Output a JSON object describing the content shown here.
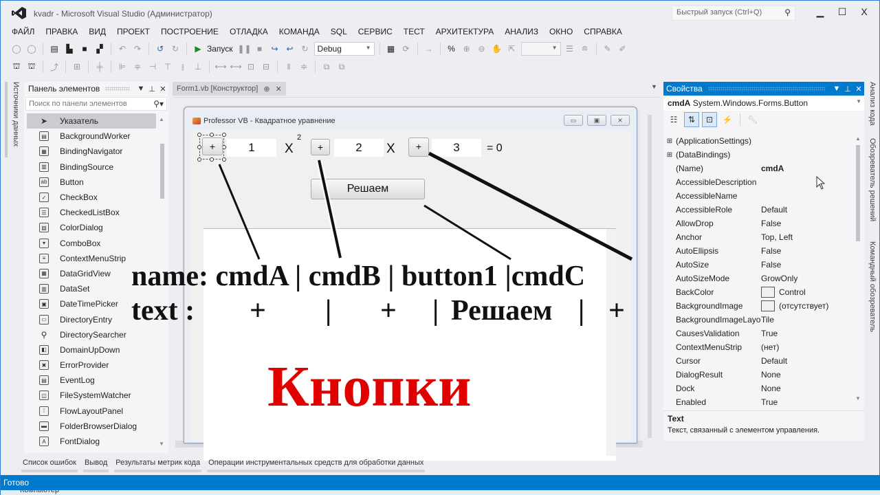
{
  "window": {
    "title": "kvadr - Microsoft Visual Studio (Администратор)",
    "quick_launch_placeholder": "Быстрый запуск (Ctrl+Q)",
    "controls": {
      "minimize": "▁",
      "maximize": "☐",
      "close": "X"
    }
  },
  "menu": [
    "ФАЙЛ",
    "ПРАВКА",
    "ВИД",
    "ПРОЕКТ",
    "ПОСТРОЕНИЕ",
    "ОТЛАДКА",
    "КОМАНДА",
    "SQL",
    "СЕРВИС",
    "ТЕСТ",
    "АРХИТЕКТУРА",
    "АНАЛИЗ",
    "ОКНО",
    "СПРАВКА"
  ],
  "toolbar": {
    "start_label": "Запуск",
    "configuration": "Debug"
  },
  "left_side_tab": "Источники данных",
  "toolbox": {
    "title": "Панель элементов",
    "search_placeholder": "Поиск по панели элементов",
    "items": [
      {
        "label": "Указатель",
        "icon": "pointer-icon",
        "glyph": "➤",
        "selected": true
      },
      {
        "label": "BackgroundWorker",
        "icon": "background-worker-icon",
        "glyph": "▤"
      },
      {
        "label": "BindingNavigator",
        "icon": "binding-navigator-icon",
        "glyph": "▦"
      },
      {
        "label": "BindingSource",
        "icon": "binding-source-icon",
        "glyph": "▥"
      },
      {
        "label": "Button",
        "icon": "button-icon",
        "glyph": "ab"
      },
      {
        "label": "CheckBox",
        "icon": "checkbox-icon",
        "glyph": "✓"
      },
      {
        "label": "CheckedListBox",
        "icon": "checked-list-box-icon",
        "glyph": "☰"
      },
      {
        "label": "ColorDialog",
        "icon": "color-dialog-icon",
        "glyph": "▧"
      },
      {
        "label": "ComboBox",
        "icon": "combobox-icon",
        "glyph": "▾"
      },
      {
        "label": "ContextMenuStrip",
        "icon": "context-menu-strip-icon",
        "glyph": "≡"
      },
      {
        "label": "DataGridView",
        "icon": "datagridview-icon",
        "glyph": "▦"
      },
      {
        "label": "DataSet",
        "icon": "dataset-icon",
        "glyph": "▥"
      },
      {
        "label": "DateTimePicker",
        "icon": "datetimepicker-icon",
        "glyph": "▣"
      },
      {
        "label": "DirectoryEntry",
        "icon": "directory-entry-icon",
        "glyph": "▭"
      },
      {
        "label": "DirectorySearcher",
        "icon": "directory-searcher-icon",
        "glyph": "⚲"
      },
      {
        "label": "DomainUpDown",
        "icon": "domain-up-down-icon",
        "glyph": "◧"
      },
      {
        "label": "ErrorProvider",
        "icon": "error-provider-icon",
        "glyph": "✖"
      },
      {
        "label": "EventLog",
        "icon": "event-log-icon",
        "glyph": "▤"
      },
      {
        "label": "FileSystemWatcher",
        "icon": "file-system-watcher-icon",
        "glyph": "◫"
      },
      {
        "label": "FlowLayoutPanel",
        "icon": "flow-layout-panel-icon",
        "glyph": "⁞"
      },
      {
        "label": "FolderBrowserDialog",
        "icon": "folder-browser-dialog-icon",
        "glyph": "▬"
      },
      {
        "label": "FontDialog",
        "icon": "font-dialog-icon",
        "glyph": "A"
      }
    ]
  },
  "document_tab": {
    "label": "Form1.vb [Конструктор]",
    "pin": "⊕",
    "close": "✕"
  },
  "form": {
    "title": "Professor VB - Квадратное уравнение",
    "controls": {
      "minimize": "▭",
      "maximize": "▣",
      "close": "✕"
    },
    "cmdA_text": "+",
    "coef_a": "1",
    "x2_label": "X",
    "exponent": "2",
    "cmdB_text": "+",
    "coef_b": "2",
    "x_label": "X",
    "cmdC_text": "+",
    "coef_c": "3",
    "equals_label": "= 0",
    "solve_button": "Решаем"
  },
  "annotations": {
    "names_line": "name: cmdA | cmdB | button1 |cmdC",
    "texts": {
      "text_label": "text :",
      "cmdA": "+",
      "sep1": "|",
      "cmdB": "+",
      "sep2": "|",
      "button1": "Решаем",
      "sep3": "|",
      "cmdC": "+"
    },
    "title": "Кнопки",
    "title_color": "#e00000"
  },
  "properties": {
    "title": "Свойства",
    "object_name": "cmdA",
    "object_type": "System.Windows.Forms.Button",
    "rows": [
      {
        "name": "(ApplicationSettings)",
        "value": "",
        "expandable": true
      },
      {
        "name": "(DataBindings)",
        "value": "",
        "expandable": true
      },
      {
        "name": "(Name)",
        "value": "cmdA",
        "bold": true
      },
      {
        "name": "AccessibleDescription",
        "value": ""
      },
      {
        "name": "AccessibleName",
        "value": ""
      },
      {
        "name": "AccessibleRole",
        "value": "Default"
      },
      {
        "name": "AllowDrop",
        "value": "False"
      },
      {
        "name": "Anchor",
        "value": "Top, Left"
      },
      {
        "name": "AutoEllipsis",
        "value": "False"
      },
      {
        "name": "AutoSize",
        "value": "False"
      },
      {
        "name": "AutoSizeMode",
        "value": "GrowOnly"
      },
      {
        "name": "BackColor",
        "value": "Control",
        "swatch": true
      },
      {
        "name": "BackgroundImage",
        "value": "(отсутствует)",
        "swatch": true
      },
      {
        "name": "BackgroundImageLayout",
        "value": "Tile"
      },
      {
        "name": "CausesValidation",
        "value": "True"
      },
      {
        "name": "ContextMenuStrip",
        "value": "(нет)"
      },
      {
        "name": "Cursor",
        "value": "Default"
      },
      {
        "name": "DialogResult",
        "value": "None"
      },
      {
        "name": "Dock",
        "value": "None"
      },
      {
        "name": "Enabled",
        "value": "True"
      }
    ],
    "description_title": "Text",
    "description_text": "Текст, связанный с элементом управления."
  },
  "right_side_tabs": [
    "Анализ кода",
    "Обозреватель решений",
    "Командный обозреватель"
  ],
  "bottom_tabs": [
    "Список ошибок",
    "Вывод",
    "Результаты метрик кода",
    "Операции инструментальных средств для обработки данных"
  ],
  "status": "Готово",
  "taskbar_peek": "Компьютер"
}
